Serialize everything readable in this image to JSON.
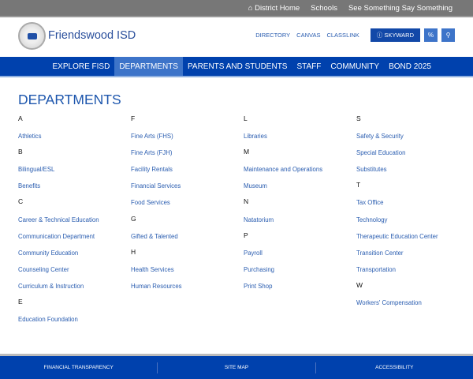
{
  "topbar": {
    "home": "District Home",
    "schools": "Schools",
    "see": "See Something Say Something"
  },
  "header": {
    "brand": "Friendswood ISD",
    "directory": "DIRECTORY",
    "canvas": "CANVAS",
    "classlink": "CLASSLINK",
    "skyward": "SKYWARD"
  },
  "nav": [
    "EXPLORE FISD",
    "DEPARTMENTS",
    "PARENTS AND STUDENTS",
    "STAFF",
    "COMMUNITY",
    "BOND 2025"
  ],
  "title": "DEPARTMENTS",
  "columns": [
    [
      {
        "h": "A"
      },
      {
        "l": "Athletics"
      },
      {
        "h": "B"
      },
      {
        "l": "Bilingual/ESL"
      },
      {
        "l": "Benefits"
      },
      {
        "h": "C"
      },
      {
        "l": "Career & Technical Education"
      },
      {
        "l": "Communication Department"
      },
      {
        "l": "Community Education"
      },
      {
        "l": "Counseling Center"
      },
      {
        "l": "Curriculum & Instruction"
      },
      {
        "h": "E"
      },
      {
        "l": "Education Foundation"
      }
    ],
    [
      {
        "h": "F"
      },
      {
        "l": "Fine Arts (FHS)"
      },
      {
        "l": "Fine Arts (FJH)"
      },
      {
        "l": "Facility Rentals"
      },
      {
        "l": "Financial Services"
      },
      {
        "l": "Food Services"
      },
      {
        "h": "G"
      },
      {
        "l": "Gifted & Talented"
      },
      {
        "h": "H"
      },
      {
        "l": "Health Services"
      },
      {
        "l": "Human Resources"
      }
    ],
    [
      {
        "h": "L"
      },
      {
        "l": "Libraries"
      },
      {
        "h": "M"
      },
      {
        "l": "Maintenance and Operations"
      },
      {
        "l": "Museum"
      },
      {
        "h": "N"
      },
      {
        "l": "Natatorium"
      },
      {
        "h": "P"
      },
      {
        "l": "Payroll"
      },
      {
        "l": "Purchasing"
      },
      {
        "l": "Print Shop"
      }
    ],
    [
      {
        "h": "S"
      },
      {
        "l": "Safety & Security"
      },
      {
        "l": "Special Education"
      },
      {
        "l": "Substitutes"
      },
      {
        "h": "T"
      },
      {
        "l": "Tax Office"
      },
      {
        "l": "Technology"
      },
      {
        "l": "Therapeutic Education Center"
      },
      {
        "l": "Transition Center"
      },
      {
        "l": "Transportation"
      },
      {
        "h": "W"
      },
      {
        "l": "Workers' Compensation"
      }
    ]
  ],
  "footer": {
    "financial": "FINANCIAL TRANSPARENCY",
    "sitemap": "SITE MAP",
    "accessibility": "ACCESSIBILITY"
  }
}
